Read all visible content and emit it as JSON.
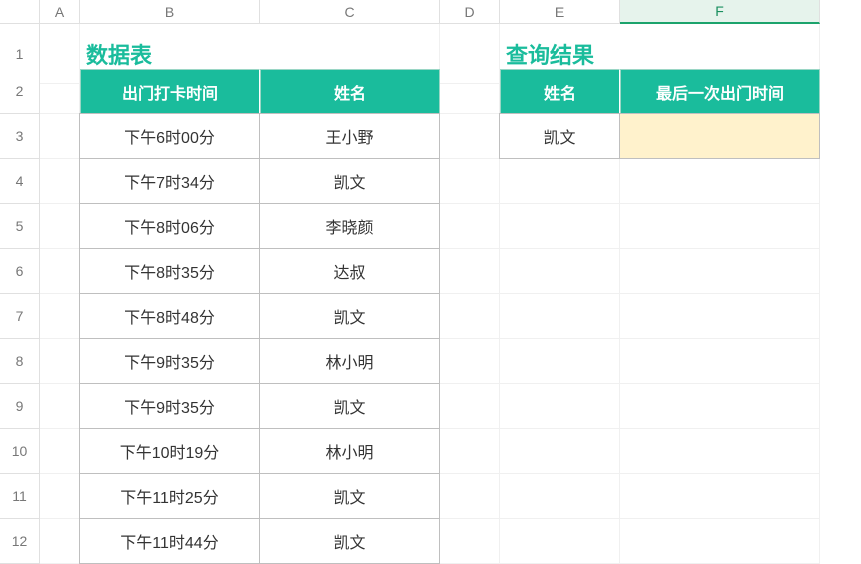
{
  "columns": [
    "A",
    "B",
    "C",
    "D",
    "E",
    "F"
  ],
  "rows": [
    "1",
    "2",
    "3",
    "4",
    "5",
    "6",
    "7",
    "8",
    "9",
    "10",
    "11",
    "12"
  ],
  "selectedColIndex": 5,
  "title_left": "数据表",
  "title_right": "查询结果",
  "table_left": {
    "headers": [
      "出门打卡时间",
      "姓名"
    ],
    "rows": [
      [
        "下午6时00分",
        "王小野"
      ],
      [
        "下午7时34分",
        "凯文"
      ],
      [
        "下午8时06分",
        "李晓颜"
      ],
      [
        "下午8时35分",
        "达叔"
      ],
      [
        "下午8时48分",
        "凯文"
      ],
      [
        "下午9时35分",
        "林小明"
      ],
      [
        "下午9时35分",
        "凯文"
      ],
      [
        "下午10时19分",
        "林小明"
      ],
      [
        "下午11时25分",
        "凯文"
      ],
      [
        "下午11时44分",
        "凯文"
      ]
    ]
  },
  "table_right": {
    "headers": [
      "姓名",
      "最后一次出门时间"
    ],
    "rows": [
      [
        "凯文",
        ""
      ]
    ]
  },
  "chart_data": {
    "type": "table",
    "tables": [
      {
        "title": "数据表",
        "columns": [
          "出门打卡时间",
          "姓名"
        ],
        "rows": [
          [
            "下午6时00分",
            "王小野"
          ],
          [
            "下午7时34分",
            "凯文"
          ],
          [
            "下午8时06分",
            "李晓颜"
          ],
          [
            "下午8时35分",
            "达叔"
          ],
          [
            "下午8时48分",
            "凯文"
          ],
          [
            "下午9时35分",
            "林小明"
          ],
          [
            "下午9时35分",
            "凯文"
          ],
          [
            "下午10时19分",
            "林小明"
          ],
          [
            "下午11时25分",
            "凯文"
          ],
          [
            "下午11时44分",
            "凯文"
          ]
        ]
      },
      {
        "title": "查询结果",
        "columns": [
          "姓名",
          "最后一次出门时间"
        ],
        "rows": [
          [
            "凯文",
            ""
          ]
        ]
      }
    ]
  }
}
